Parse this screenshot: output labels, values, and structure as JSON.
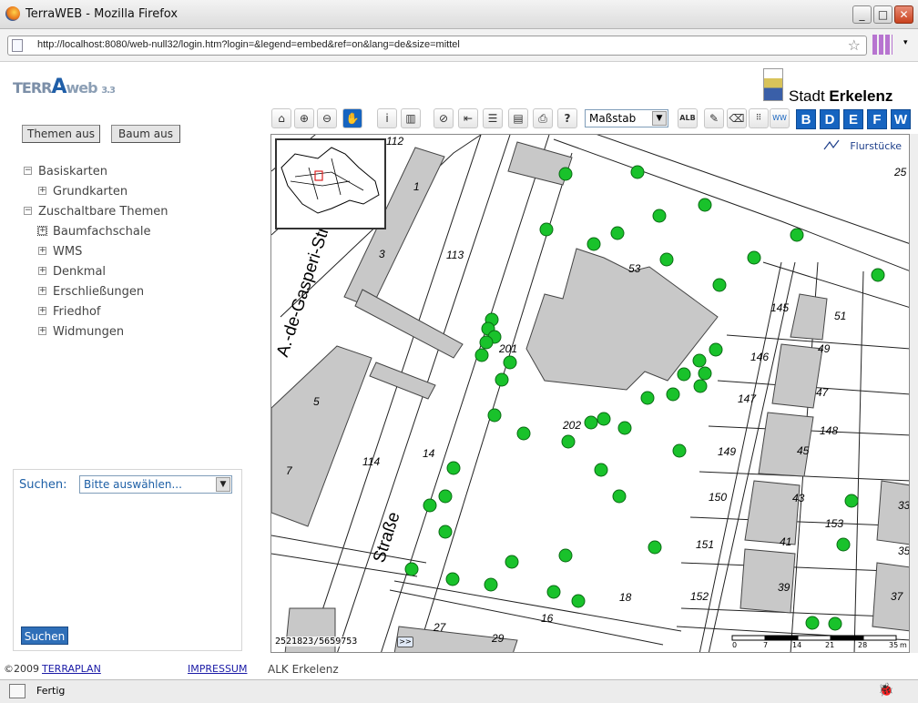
{
  "window": {
    "title": "TerraWEB - Mozilla Firefox"
  },
  "browser": {
    "url": "http://localhost:8080/web-null32/login.htm?login=&legend=embed&ref=on&lang=de&size=mittel"
  },
  "header": {
    "logo_terra": "TERR",
    "logo_a": "A",
    "logo_web": "web",
    "logo_version": "3.3",
    "stadt_prefix": "Stadt ",
    "stadt_name": "Erkelenz"
  },
  "sidebar": {
    "themen_button": "Themen aus",
    "baum_button": "Baum aus",
    "tree": [
      {
        "label": "Basiskarten",
        "level": 0,
        "state": "minus"
      },
      {
        "label": "Grundkarten",
        "level": 1,
        "state": "plus"
      },
      {
        "label": "Zuschaltbare Themen",
        "level": 0,
        "state": "minus"
      },
      {
        "label": "Baumfachschale",
        "level": 1,
        "state": "plus"
      },
      {
        "label": "WMS",
        "level": 1,
        "state": "plus"
      },
      {
        "label": "Denkmal",
        "level": 1,
        "state": "plus"
      },
      {
        "label": "Erschließungen",
        "level": 1,
        "state": "plus"
      },
      {
        "label": "Friedhof",
        "level": 1,
        "state": "plus"
      },
      {
        "label": "Widmungen",
        "level": 1,
        "state": "plus"
      }
    ],
    "search": {
      "label": "Suchen:",
      "select_value": "Bitte auswählen...",
      "button": "Suchen"
    }
  },
  "footer": {
    "copyright": "©2009 ",
    "terraplan": "TERRAPLAN",
    "impressum": "IMPRESSUM",
    "layer": "ALK Erkelenz"
  },
  "toolbar": {
    "massstab": "Maßstab",
    "letters": [
      "B",
      "D",
      "E",
      "F",
      "W"
    ],
    "alb": "ALB",
    "help": "?",
    "ww": "WW"
  },
  "map": {
    "coords": "2521823/5659753",
    "expand": ">>",
    "legend_flurstuecke": "Flurstücke",
    "scale_labels": [
      "0",
      "7",
      "14",
      "21",
      "28",
      "35",
      "m"
    ],
    "street_labels": [
      "A.-de-Gasperi-Str",
      "Straße"
    ],
    "parcel_labels": [
      "112",
      "113",
      "114",
      "145",
      "146",
      "147",
      "148",
      "149",
      "150",
      "151",
      "152",
      "153",
      "201",
      "202",
      "14",
      "16",
      "18",
      "25",
      "27",
      "29",
      "1",
      "3",
      "5",
      "7",
      "53",
      "51",
      "49",
      "47",
      "45",
      "43",
      "41",
      "39",
      "37",
      "35",
      "33"
    ]
  },
  "status": {
    "text": "Fertig"
  }
}
